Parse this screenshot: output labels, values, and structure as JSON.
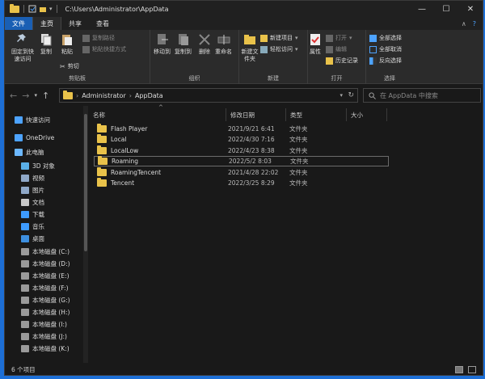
{
  "window": {
    "path": "C:\\Users\\Administrator\\AppData",
    "controls": [
      "—",
      "☐",
      "✕"
    ]
  },
  "tabs": [
    {
      "label": "文件"
    },
    {
      "label": "主页"
    },
    {
      "label": "共享"
    },
    {
      "label": "查看"
    }
  ],
  "ribbon": {
    "clipboard": {
      "label": "剪贴板",
      "pin": "固定到快速访问",
      "copy": "复制",
      "paste": "粘贴",
      "copy_path": "复制路径",
      "paste_shortcut": "粘贴快捷方式",
      "cut": "剪切"
    },
    "organize": {
      "label": "组织",
      "move_to": "移动到",
      "copy_to": "复制到",
      "delete": "删除",
      "rename": "重命名"
    },
    "new": {
      "label": "新建",
      "new_folder": "新建文件夹",
      "new_item": "新建项目",
      "easy_access": "轻松访问"
    },
    "open": {
      "label": "打开",
      "properties": "属性",
      "open": "打开",
      "edit": "编辑",
      "history": "历史记录"
    },
    "select": {
      "label": "选择",
      "select_all": "全部选择",
      "select_none": "全部取消",
      "invert": "反向选择"
    }
  },
  "address": {
    "crumbs": [
      "Administrator",
      "AppData"
    ],
    "search_placeholder": "在 AppData 中搜索"
  },
  "nav_pane": [
    {
      "label": "快速访问",
      "icon": "star-icon",
      "color": "#4da3ff"
    },
    {
      "label": "OneDrive",
      "icon": "cloud-icon",
      "color": "#4da3ff"
    },
    {
      "label": "此电脑",
      "icon": "pc-icon",
      "color": "#6cb8ff"
    },
    {
      "label": "3D 对象",
      "icon": "cube-icon",
      "color": "#5ab0e8"
    },
    {
      "label": "视频",
      "icon": "video-icon",
      "color": "#8fa8c8"
    },
    {
      "label": "图片",
      "icon": "picture-icon",
      "color": "#8fa8c8"
    },
    {
      "label": "文档",
      "icon": "document-icon",
      "color": "#c8c8c8"
    },
    {
      "label": "下载",
      "icon": "download-icon",
      "color": "#3d9bff"
    },
    {
      "label": "音乐",
      "icon": "music-icon",
      "color": "#3d9bff"
    },
    {
      "label": "桌面",
      "icon": "desktop-icon",
      "color": "#3d8fe0"
    },
    {
      "label": "本地磁盘 (C:)",
      "icon": "drive-icon",
      "color": "#9a9a9a"
    },
    {
      "label": "本地磁盘 (D:)",
      "icon": "drive-icon",
      "color": "#9a9a9a"
    },
    {
      "label": "本地磁盘 (E:)",
      "icon": "drive-icon",
      "color": "#9a9a9a"
    },
    {
      "label": "本地磁盘 (F:)",
      "icon": "drive-icon",
      "color": "#9a9a9a"
    },
    {
      "label": "本地磁盘 (G:)",
      "icon": "drive-icon",
      "color": "#9a9a9a"
    },
    {
      "label": "本地磁盘 (H:)",
      "icon": "drive-icon",
      "color": "#9a9a9a"
    },
    {
      "label": "本地磁盘 (I:)",
      "icon": "drive-icon",
      "color": "#9a9a9a"
    },
    {
      "label": "本地磁盘 (J:)",
      "icon": "drive-icon",
      "color": "#9a9a9a"
    },
    {
      "label": "本地磁盘 (K:)",
      "icon": "drive-icon",
      "color": "#9a9a9a"
    }
  ],
  "columns": [
    "名称",
    "修改日期",
    "类型",
    "大小"
  ],
  "files": [
    {
      "name": "Flash Player",
      "date": "2021/9/21 6:41",
      "type": "文件夹"
    },
    {
      "name": "Local",
      "date": "2022/4/30 7:16",
      "type": "文件夹"
    },
    {
      "name": "LocalLow",
      "date": "2022/4/23 8:38",
      "type": "文件夹"
    },
    {
      "name": "Roaming",
      "date": "2022/5/2 8:03",
      "type": "文件夹"
    },
    {
      "name": "RoamingTencent",
      "date": "2021/4/28 22:02",
      "type": "文件夹"
    },
    {
      "name": "Tencent",
      "date": "2022/3/25 8:29",
      "type": "文件夹"
    }
  ],
  "status": {
    "count": "6 个项目"
  },
  "colors": {
    "folder": "#e9c24a",
    "file_tab": "#1a5fb4",
    "accent": "#4da3ff"
  }
}
